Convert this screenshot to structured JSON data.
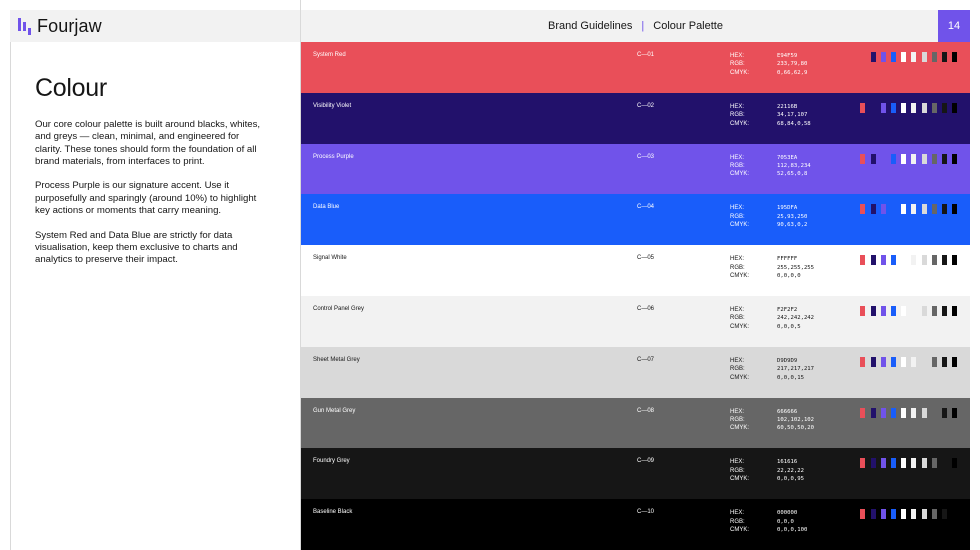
{
  "brand": {
    "name": "Fourjaw",
    "accent": "#7053EA"
  },
  "header": {
    "section": "Brand Guidelines",
    "separator": "|",
    "subsection": "Colour Palette",
    "page_number": "14"
  },
  "content": {
    "title": "Colour",
    "paragraphs": [
      "Our core colour palette is built around blacks, whites, and greys — clean, minimal, and engineered for clarity. These tones should form the foundation of all brand materials, from interfaces to print.",
      "Process Purple is our signature accent. Use it purposefully and sparingly (around 10%) to highlight key actions or moments that carry meaning.",
      "System Red and Data Blue are strictly for data visualisation, keep them exclusive to charts and analytics to preserve their impact."
    ]
  },
  "value_labels": {
    "hex": "HEX:",
    "rgb": "RGB:",
    "cmyk": "CMYK:"
  },
  "swatches": [
    {
      "name": "System Red",
      "code": "C—01",
      "hex": "E94F59",
      "rgb": "233,79,80",
      "cmyk": "0,66,62,9",
      "color": "#E94F59",
      "text_color": "#FFFFFF"
    },
    {
      "name": "Visibility Violet",
      "code": "C—02",
      "hex": "22116B",
      "rgb": "34,17,107",
      "cmyk": "68,84,0,58",
      "color": "#22116B",
      "text_color": "#FFFFFF"
    },
    {
      "name": "Process Purple",
      "code": "C—03",
      "hex": "7053EA",
      "rgb": "112,83,234",
      "cmyk": "52,65,0,8",
      "color": "#7053EA",
      "text_color": "#FFFFFF"
    },
    {
      "name": "Data Blue",
      "code": "C—04",
      "hex": "195DFA",
      "rgb": "25,93,250",
      "cmyk": "90,63,0,2",
      "color": "#195DFA",
      "text_color": "#FFFFFF"
    },
    {
      "name": "Signal White",
      "code": "C—05",
      "hex": "FFFFFF",
      "rgb": "255,255,255",
      "cmyk": "0,0,0,0",
      "color": "#FFFFFF",
      "text_color": "#161616"
    },
    {
      "name": "Control Panel Grey",
      "code": "C—06",
      "hex": "F2F2F2",
      "rgb": "242,242,242",
      "cmyk": "0,0,0,5",
      "color": "#F2F2F2",
      "text_color": "#161616"
    },
    {
      "name": "Sheet Metal Grey",
      "code": "C—07",
      "hex": "D9D9D9",
      "rgb": "217,217,217",
      "cmyk": "0,0,0,15",
      "color": "#D9D9D9",
      "text_color": "#161616"
    },
    {
      "name": "Gun Metal Grey",
      "code": "C—08",
      "hex": "666666",
      "rgb": "102,102,102",
      "cmyk": "60,50,50,20",
      "color": "#666666",
      "text_color": "#FFFFFF"
    },
    {
      "name": "Foundry Grey",
      "code": "C—09",
      "hex": "161616",
      "rgb": "22,22,22",
      "cmyk": "0,0,0,95",
      "color": "#161616",
      "text_color": "#FFFFFF"
    },
    {
      "name": "Baseline Black",
      "code": "C—10",
      "hex": "000000",
      "rgb": "0,0,0",
      "cmyk": "0,0,0,100",
      "color": "#000000",
      "text_color": "#FFFFFF"
    }
  ]
}
